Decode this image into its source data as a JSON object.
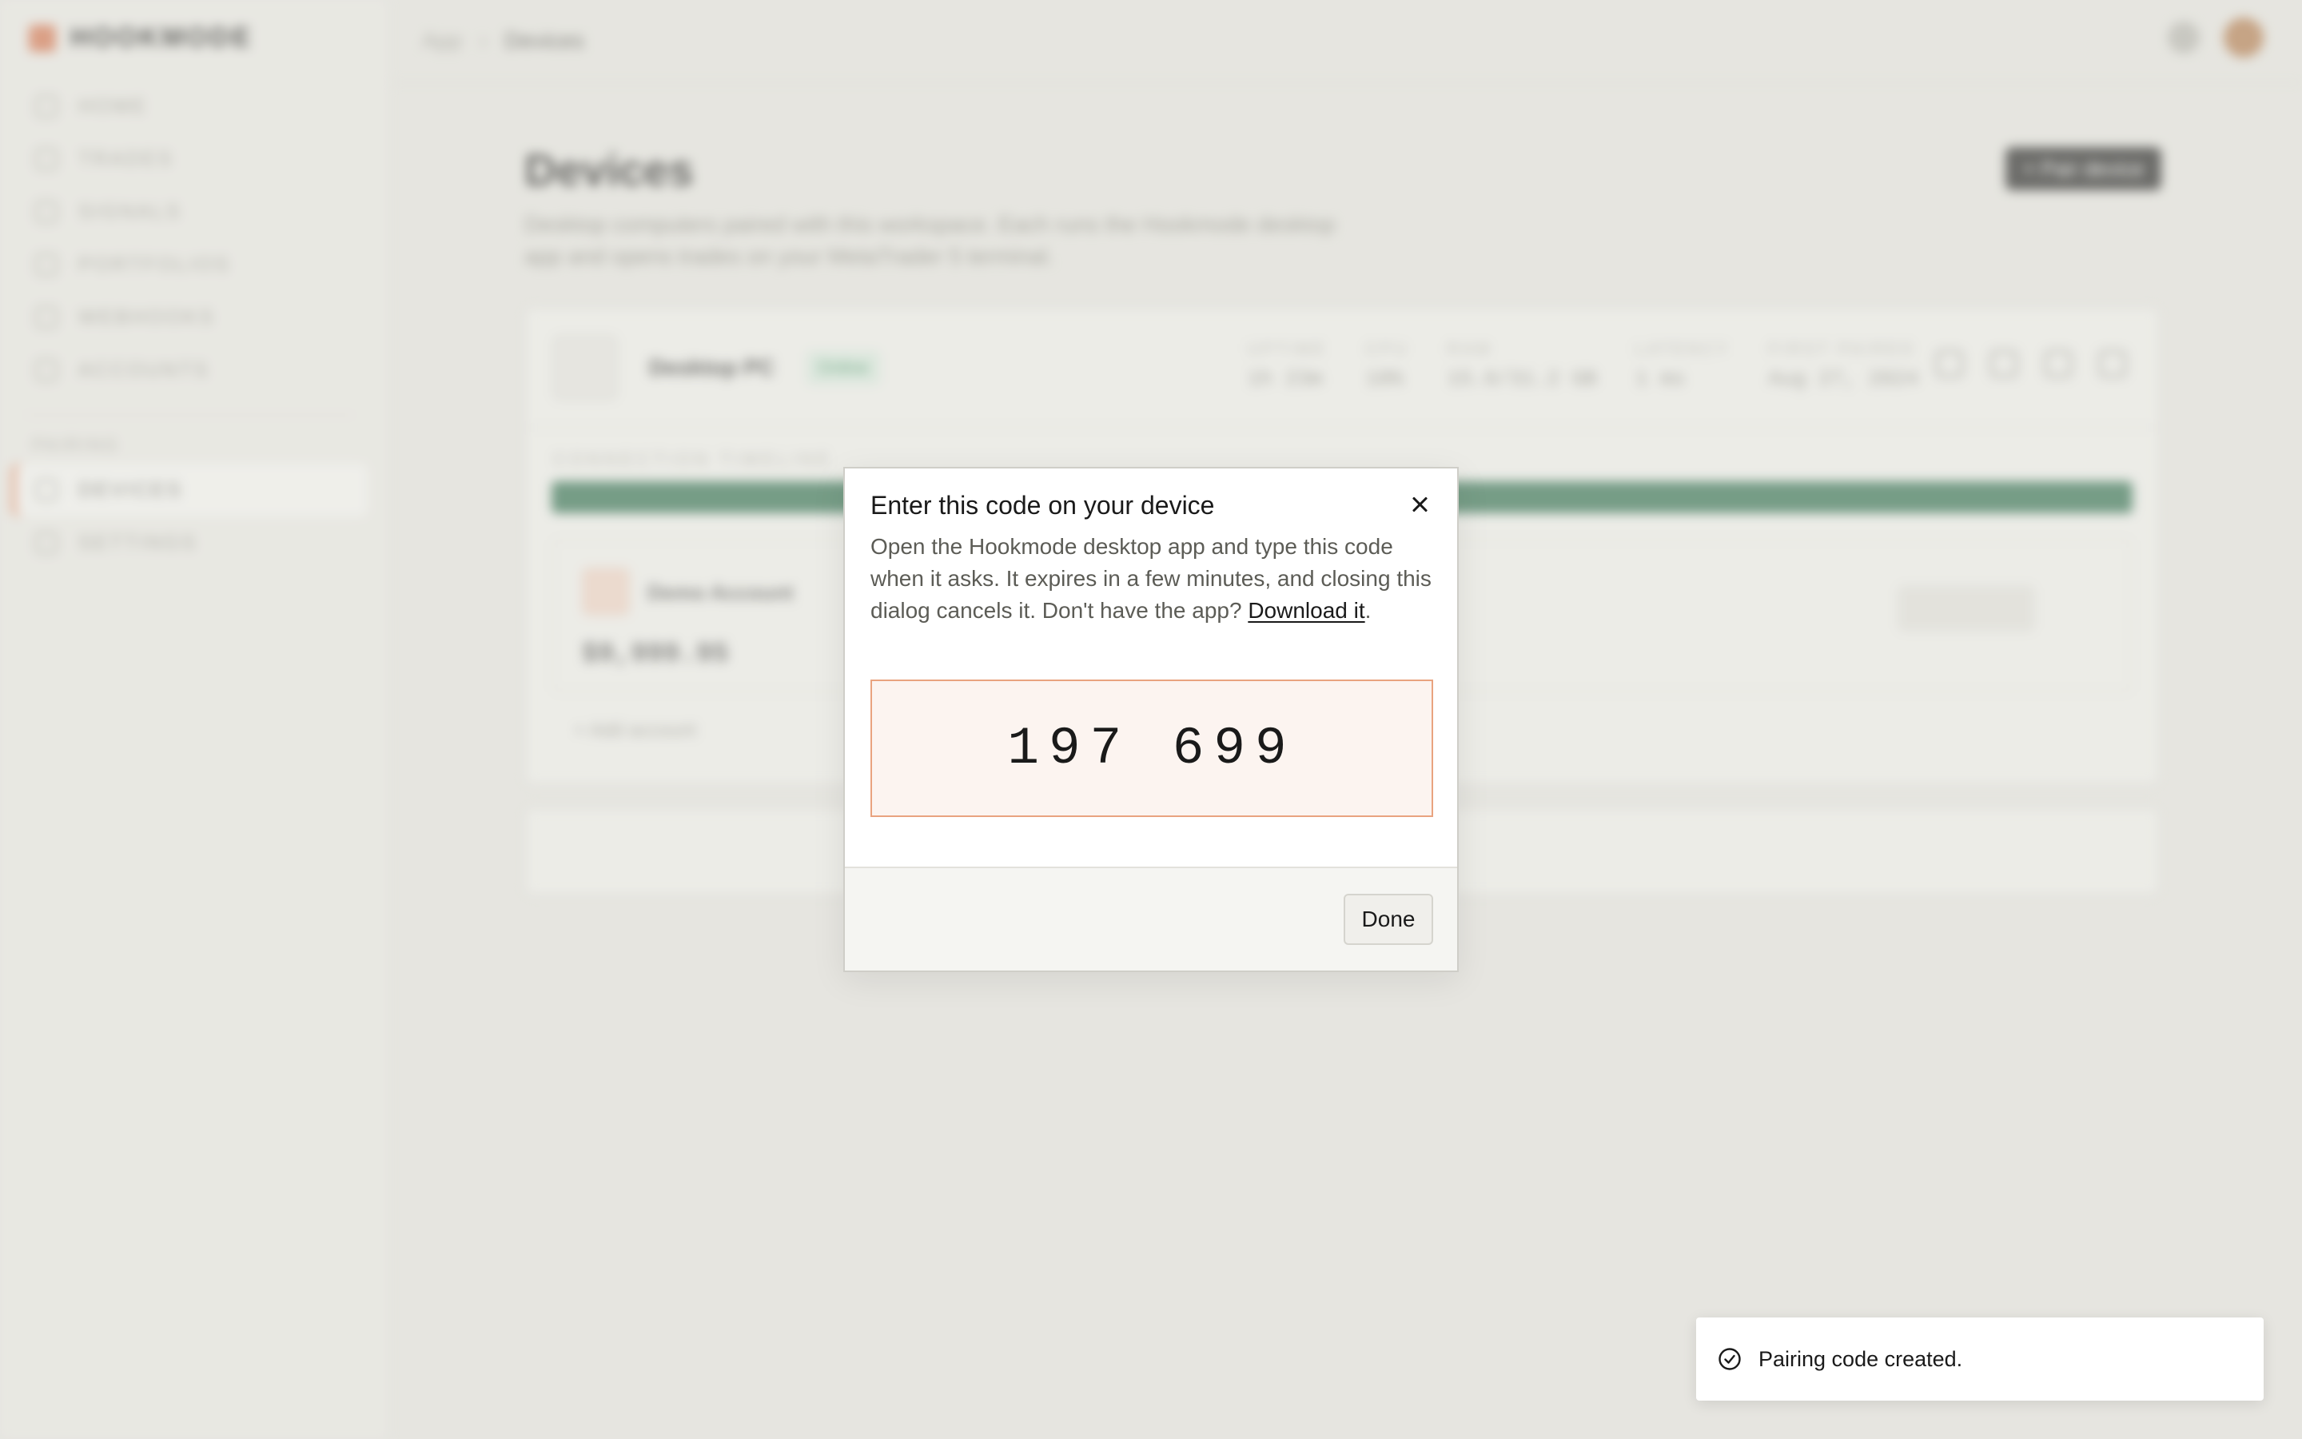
{
  "app": {
    "logo": "HOOKMODE",
    "nav": [
      {
        "label": "HOME"
      },
      {
        "label": "TRADES"
      },
      {
        "label": "SIGNALS"
      },
      {
        "label": "PORTFOLIOS"
      },
      {
        "label": "WEBHOOKS"
      },
      {
        "label": "ACCOUNTS"
      }
    ],
    "nav_section": "PAIRING",
    "nav_pairing": [
      {
        "label": "DEVICES",
        "active": true
      },
      {
        "label": "SETTINGS"
      }
    ],
    "breadcrumb": {
      "root": "App",
      "current": "Devices"
    }
  },
  "page": {
    "title": "Devices",
    "description": "Desktop computers paired with this workspace. Each runs the Hookmode desktop app and opens trades on your MetaTrader 5 terminal.",
    "pair_button": "+ Pair device",
    "device": {
      "name": "Desktop PC",
      "status": "Online",
      "stats": [
        {
          "label": "UPTIME",
          "value": "1h 23m"
        },
        {
          "label": "CPU",
          "value": "18%"
        },
        {
          "label": "RAM",
          "value": "15.6/31.2 GB"
        },
        {
          "label": "LATENCY",
          "value": "1 ms"
        },
        {
          "label": "FIRST PAIRED",
          "value": "Aug 27, 2024"
        }
      ],
      "timeline_label": "CONNECTION TIMELINE",
      "account": {
        "name": "Demo Account",
        "balance": "$9,999.95"
      },
      "add_account": "+ Add account"
    }
  },
  "modal": {
    "title": "Enter this code on your device",
    "body": "Open the Hookmode desktop app and type this code when it asks. It expires in a few minutes, and closing this dialog cancels it. Don't have the app? ",
    "download_link": "Download it",
    "body_end": ".",
    "code": "197 699",
    "done_label": "Done"
  },
  "toast": {
    "message": "Pairing code created."
  },
  "colors": {
    "accent": "#e9a37f",
    "code_bg": "#fcf4f0",
    "timeline": "#2c6e4d"
  }
}
